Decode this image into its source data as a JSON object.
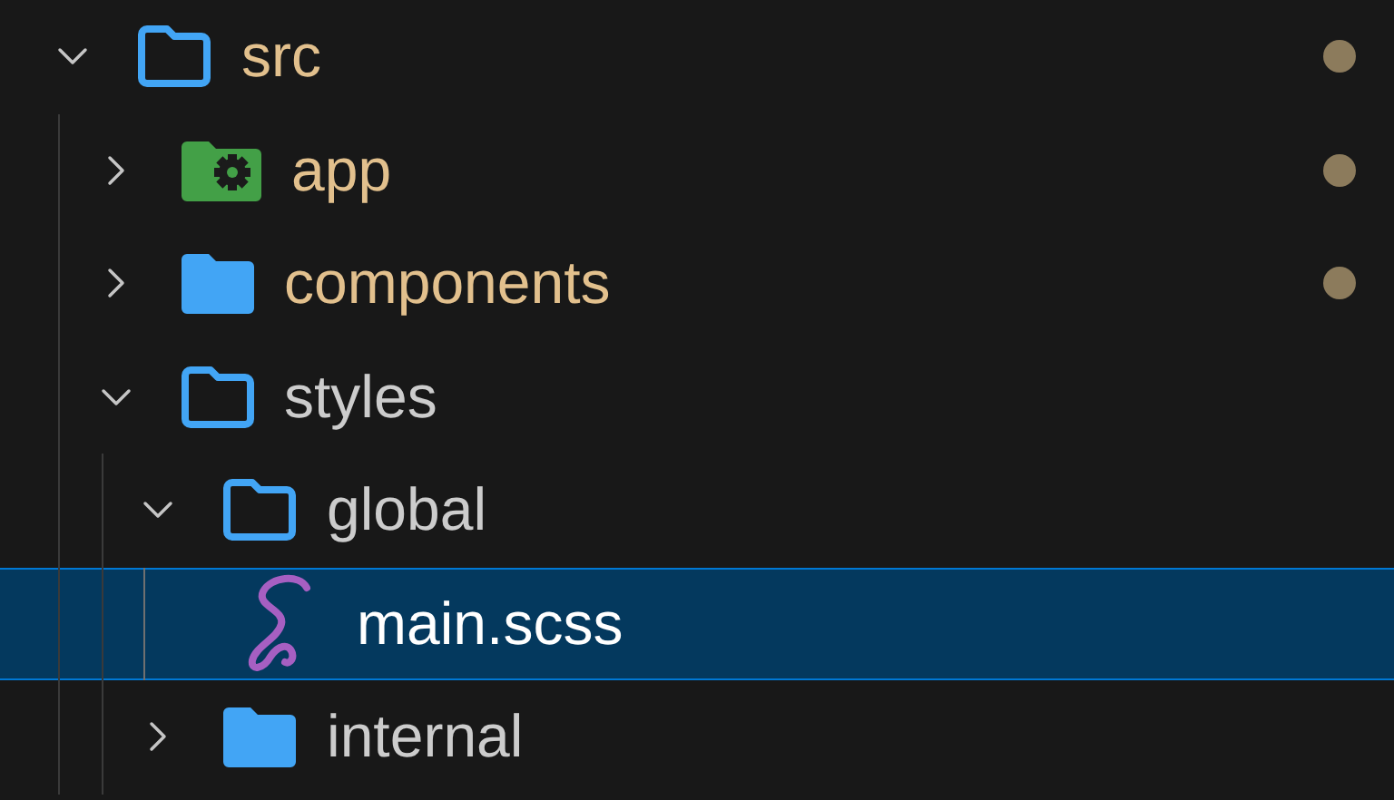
{
  "tree": [
    {
      "name": "src",
      "kind": "folder",
      "expanded": true,
      "modified": true,
      "selected": false,
      "children": [
        {
          "name": "app",
          "kind": "gear-folder",
          "expanded": false,
          "modified": true,
          "selected": false
        },
        {
          "name": "components",
          "kind": "folder",
          "expanded": false,
          "modified": true,
          "selected": false
        },
        {
          "name": "styles",
          "kind": "folder",
          "expanded": true,
          "modified": false,
          "selected": false,
          "children": [
            {
              "name": "global",
              "kind": "folder",
              "expanded": true,
              "modified": false,
              "selected": false,
              "children": [
                {
                  "name": "main.scss",
                  "kind": "sass-file",
                  "modified": false,
                  "selected": true
                }
              ]
            },
            {
              "name": "internal",
              "kind": "folder",
              "expanded": false,
              "modified": false,
              "selected": false
            }
          ]
        }
      ]
    }
  ]
}
